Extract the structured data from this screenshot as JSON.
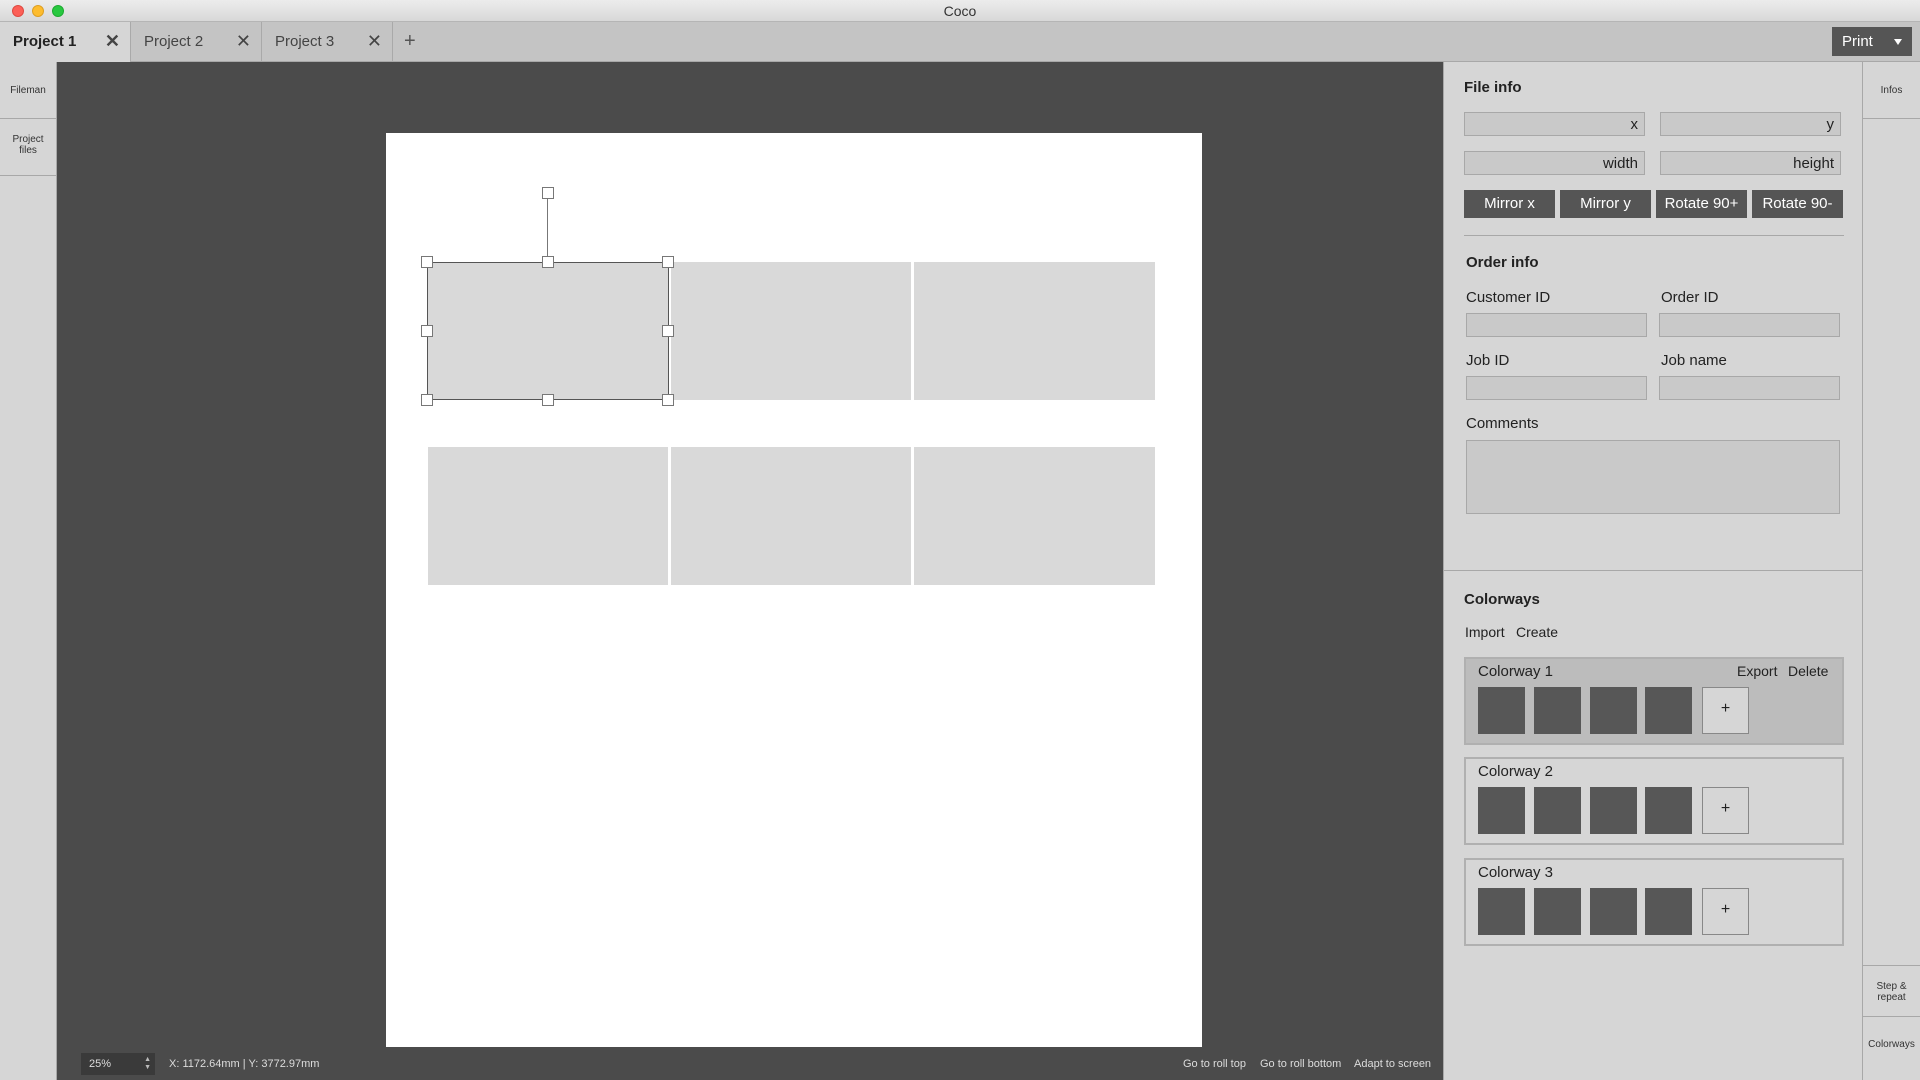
{
  "window": {
    "title": "Coco"
  },
  "tabs": [
    {
      "label": "Project 1",
      "active": true
    },
    {
      "label": "Project 2",
      "active": false
    },
    {
      "label": "Project 3",
      "active": false
    }
  ],
  "tab_close_glyph": "✕",
  "tab_add_glyph": "+",
  "print_button": {
    "label": "Print"
  },
  "left_sidebar": {
    "items": [
      {
        "label": "Fileman"
      },
      {
        "label": "Project files"
      }
    ]
  },
  "statusbar": {
    "zoom": "25%",
    "coords": "X: 1172.64mm | Y: 3772.97mm",
    "go_top": "Go to roll top",
    "go_bottom": "Go to roll bottom",
    "adapt": "Adapt to screen"
  },
  "file_info": {
    "title": "File info",
    "x_placeholder": "x",
    "y_placeholder": "y",
    "width_placeholder": "width",
    "height_placeholder": "height",
    "actions": [
      "Mirror x",
      "Mirror y",
      "Rotate 90+",
      "Rotate 90-"
    ]
  },
  "order_info": {
    "title": "Order info",
    "customer_id": "Customer ID",
    "order_id": "Order ID",
    "job_id": "Job ID",
    "job_name": "Job name",
    "comments": "Comments"
  },
  "colorways": {
    "title": "Colorways",
    "import": "Import",
    "create": "Create",
    "export": "Export",
    "delete": "Delete",
    "add_glyph": "+",
    "items": [
      {
        "name": "Colorway 1",
        "active": true
      },
      {
        "name": "Colorway 2",
        "active": false
      },
      {
        "name": "Colorway 3",
        "active": false
      }
    ],
    "swatch_color": "#575757"
  },
  "right_sidebar": {
    "infos": "Infos",
    "step_repeat": "Step & repeat",
    "colorways": "Colorways"
  }
}
